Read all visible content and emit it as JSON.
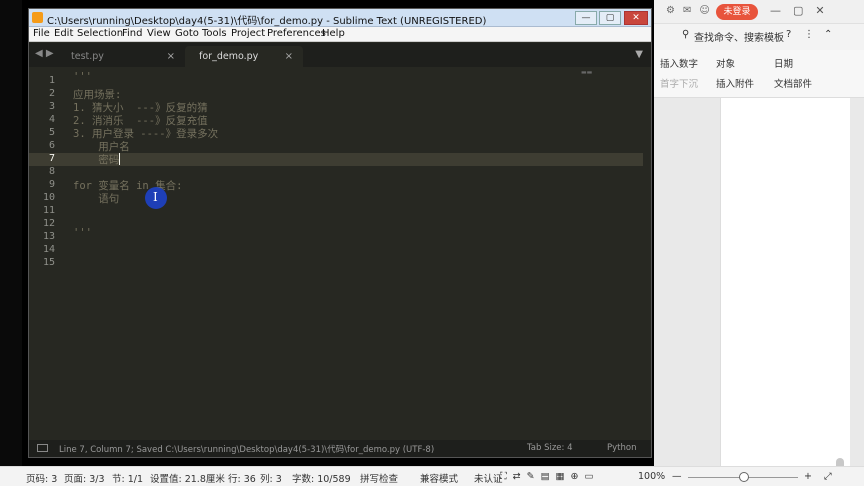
{
  "window": {
    "title": "C:\\Users\\running\\Desktop\\day4(5-31)\\代码\\for_demo.py - Sublime Text (UNREGISTERED)",
    "minimize": "—",
    "maximize": "▢",
    "close": "✕"
  },
  "menu": [
    "File",
    "Edit",
    "Selection",
    "Find",
    "View",
    "Goto",
    "Tools",
    "Project",
    "Preferences",
    "Help"
  ],
  "tabs": {
    "nav": "◀ ▶",
    "items": [
      {
        "label": "test.py",
        "close": "×"
      },
      {
        "label": "for_demo.py",
        "close": "×"
      }
    ],
    "dropdown": "▼"
  },
  "editor": {
    "line_numbers": [
      "1",
      "2",
      "3",
      "4",
      "5",
      "6",
      "7",
      "8",
      "9",
      "10",
      "11",
      "12",
      "13",
      "14",
      "15"
    ],
    "current_line": 7,
    "lines": [
      "'''",
      "应用场景:",
      "1. 猜大小  ---》反复的猜",
      "2. 消消乐  ---》反复充值",
      "3. 用户登录 ----》登录多次",
      "    用户名",
      "    密码",
      "",
      "for 变量名 in 集合:",
      "    语句",
      "",
      "",
      "'''",
      "",
      ""
    ]
  },
  "status": {
    "text": "Line 7, Column 7; Saved C:\\Users\\running\\Desktop\\day4(5-31)\\代码\\for_demo.py (UTF-8)",
    "tab_size": "Tab Size: 4",
    "syntax": "Python"
  },
  "wps": {
    "login": "未登录",
    "search": "查找命令、搜索模板",
    "ribbon": {
      "insert_number": "插入数字",
      "object": "对象",
      "date": "日期",
      "first_indent": "首字下沉",
      "insert_attachment": "插入附件",
      "doc_parts": "文档部件"
    }
  },
  "bottom_status": {
    "page_code": "页码: 3",
    "page": "页面: 3/3",
    "section": "节: 1/1",
    "setting": "设置值: 21.8厘米",
    "row": "行: 36",
    "col": "列: 3",
    "words": "字数: 10/589",
    "spell": "拼写检查",
    "compat": "兼容模式",
    "unauth": "未认证",
    "zoom": "100%",
    "zoom_minus": "—",
    "zoom_plus": "+"
  }
}
